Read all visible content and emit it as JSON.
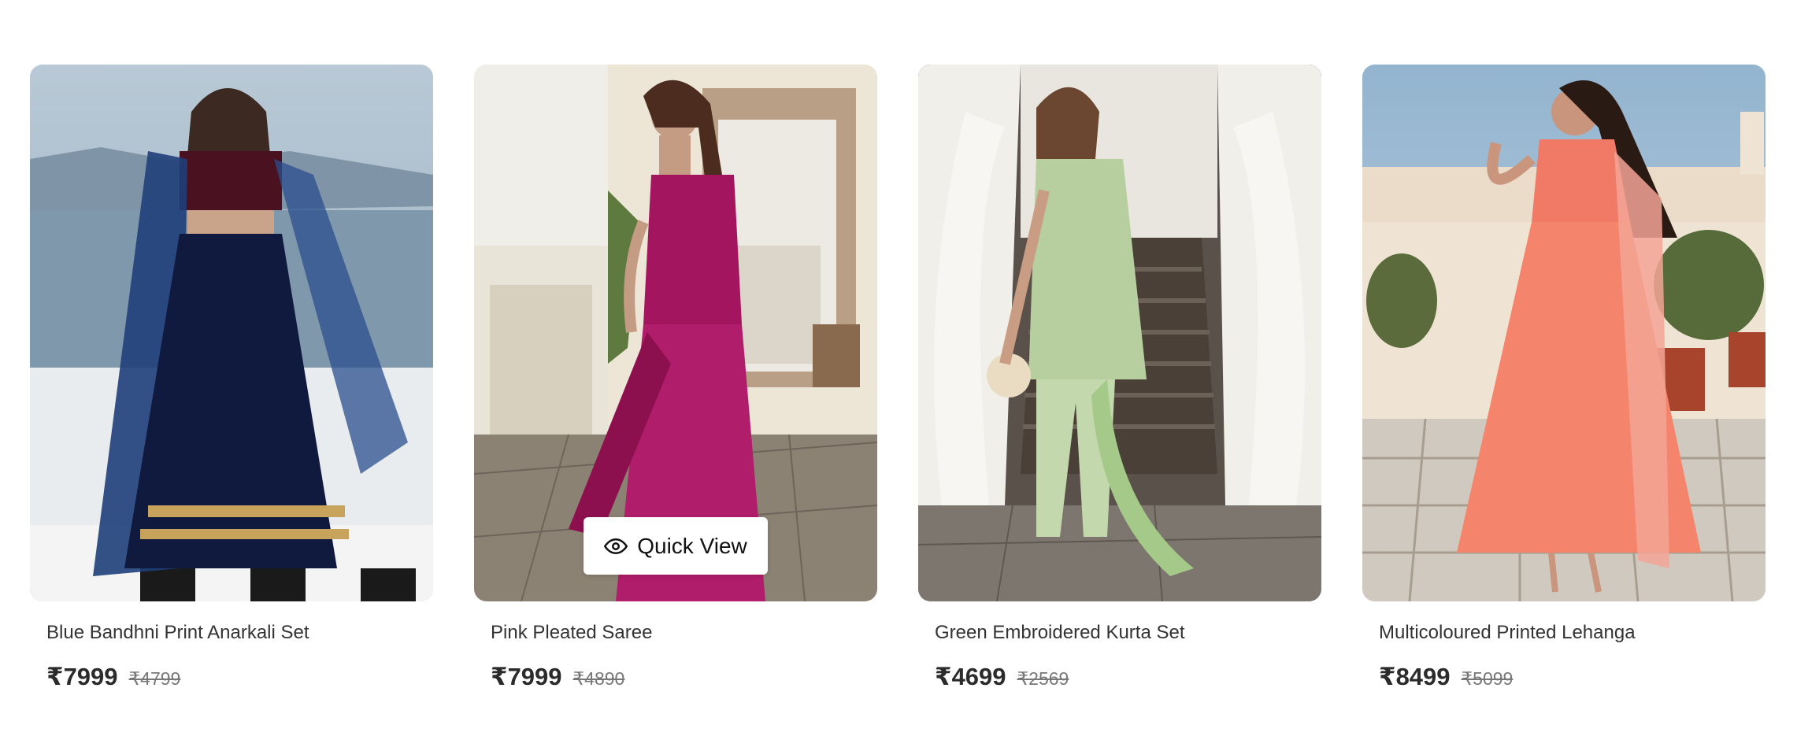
{
  "products": [
    {
      "image": "woman in navy lehenga with dupatta by a lake terrace",
      "title": "Blue Bandhni Print Anarkali Set",
      "price": "₹7999",
      "mrp": "₹4799"
    },
    {
      "image": "woman in magenta pleated saree near ornate mirror",
      "title": "Pink Pleated Saree",
      "price": "₹7999",
      "mrp": "₹4890"
    },
    {
      "image": "woman in pale green kurta set on staircase",
      "title": "Green Embroidered Kurta Set",
      "price": "₹4699",
      "mrp": "₹2569"
    },
    {
      "image": "woman in coral anarkali on patterned terrace",
      "title": "Multicoloured Printed Lehanga",
      "price": "₹8499",
      "mrp": "₹5099"
    }
  ],
  "quick_view": {
    "label": "Quick View",
    "icon": "eye-icon"
  },
  "colors": {
    "price": "#2b2b2b",
    "mrp": "#777777",
    "background": "#ffffff"
  }
}
